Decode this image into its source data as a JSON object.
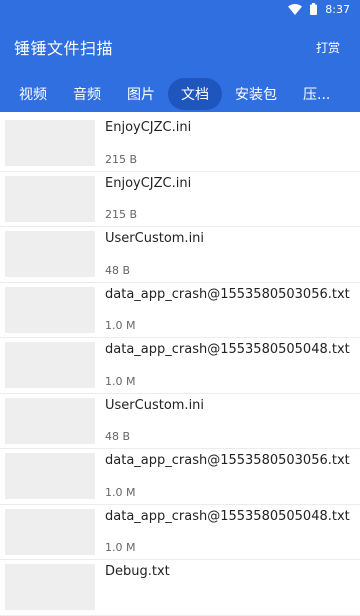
{
  "status": {
    "time": "8:37"
  },
  "app": {
    "title": "锤锤文件扫描",
    "tip_label": "打赏"
  },
  "tabs": [
    {
      "label": "视频"
    },
    {
      "label": "音频"
    },
    {
      "label": "图片"
    },
    {
      "label": "文档"
    },
    {
      "label": "安装包"
    },
    {
      "label": "压..."
    }
  ],
  "files": [
    {
      "name": "EnjoyCJZC.ini",
      "size": "215 B"
    },
    {
      "name": "EnjoyCJZC.ini",
      "size": "215 B"
    },
    {
      "name": "UserCustom.ini",
      "size": "48 B"
    },
    {
      "name": "data_app_crash@1553580503056.txt",
      "size": "1.0 M"
    },
    {
      "name": "data_app_crash@1553580505048.txt",
      "size": "1.0 M"
    },
    {
      "name": "UserCustom.ini",
      "size": "48 B"
    },
    {
      "name": "data_app_crash@1553580503056.txt",
      "size": "1.0 M"
    },
    {
      "name": "data_app_crash@1553580505048.txt",
      "size": "1.0 M"
    },
    {
      "name": "Debug.txt",
      "size": ""
    }
  ]
}
